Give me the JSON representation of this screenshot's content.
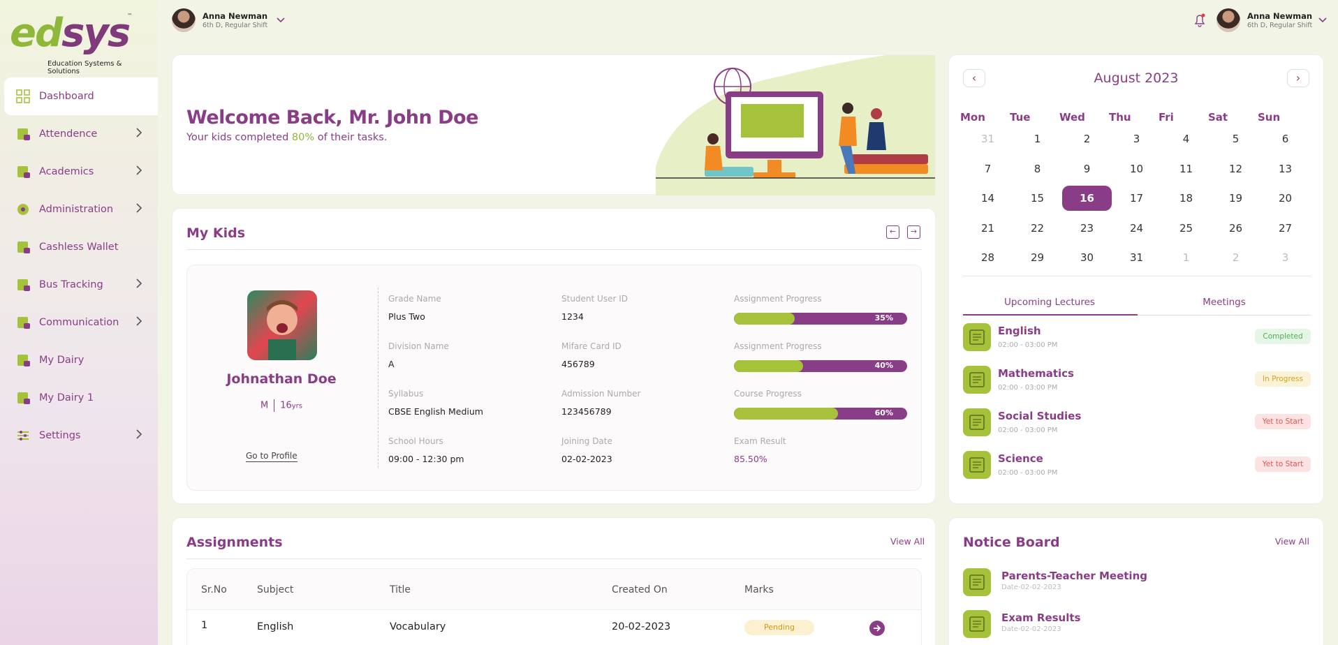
{
  "brand": {
    "name_part1": "ed",
    "name_part2": "sys",
    "tm": "™",
    "tagline": "Education Systems & Solutions"
  },
  "sidebar": {
    "items": [
      {
        "label": "Dashboard",
        "icon": "grid-icon",
        "active": true,
        "chevron": false
      },
      {
        "label": "Attendence",
        "icon": "attendance-icon",
        "active": false,
        "chevron": true
      },
      {
        "label": "Academics",
        "icon": "book-icon",
        "active": false,
        "chevron": true
      },
      {
        "label": "Administration",
        "icon": "cog-icon",
        "active": false,
        "chevron": true
      },
      {
        "label": "Cashless Wallet",
        "icon": "wallet-icon",
        "active": false,
        "chevron": false
      },
      {
        "label": "Bus Tracking",
        "icon": "bus-icon",
        "active": false,
        "chevron": true
      },
      {
        "label": "Communication",
        "icon": "chat-icon",
        "active": false,
        "chevron": true
      },
      {
        "label": "My Dairy",
        "icon": "diary-icon",
        "active": false,
        "chevron": false
      },
      {
        "label": "My Dairy 1",
        "icon": "diary-icon",
        "active": false,
        "chevron": false
      },
      {
        "label": "Settings",
        "icon": "sliders-icon",
        "active": false,
        "chevron": true
      }
    ]
  },
  "topbar": {
    "left_user": {
      "name": "Anna Newman",
      "meta": "6th D, Regular Shift"
    },
    "right_user": {
      "name": "Anna Newman",
      "meta": "6th D, Regular Shift"
    }
  },
  "welcome": {
    "title": "Welcome Back, Mr. John Doe",
    "sub_before": "Your kids completed ",
    "sub_pct": "80%",
    "sub_after": " of their tasks."
  },
  "kids": {
    "title": "My Kids",
    "name": "Johnathan Doe",
    "gender": "M",
    "age": "16",
    "age_unit": "yrs",
    "profile_link": "Go to Profile",
    "fields": {
      "grade_label": "Grade Name",
      "grade": "Plus Two",
      "userid_label": "Student User ID",
      "userid": "1234",
      "division_label": "Division Name",
      "division": "A",
      "mifare_label": "Mifare Card ID",
      "mifare": "456789",
      "syllabus_label": "Syllabus",
      "syllabus": "CBSE English Medium",
      "admission_label": "Admission Number",
      "admission": "123456789",
      "hours_label": "School Hours",
      "hours": "09:00 - 12:30 pm",
      "joining_label": "Joining Date",
      "joining": "02-02-2023",
      "exam_label": "Exam Result",
      "exam": "85.50%"
    },
    "progress": [
      {
        "label": "Assignment Progress",
        "value": 35,
        "text": "35%"
      },
      {
        "label": "Assignment Progress",
        "value": 40,
        "text": "40%"
      },
      {
        "label": "Course Progress",
        "value": 60,
        "text": "60%"
      }
    ]
  },
  "assignments": {
    "title": "Assignments",
    "view_all": "View All",
    "headers": [
      "Sr.No",
      "Subject",
      "Title",
      "Created On",
      "Marks"
    ],
    "rows": [
      {
        "srno": "1",
        "subject": "English",
        "title": "Vocabulary",
        "created": "20-02-2023",
        "marks": "Pending"
      }
    ]
  },
  "calendar": {
    "title": "August 2023",
    "dow": [
      "Mon",
      "Tue",
      "Wed",
      "Thu",
      "Fri",
      "Sat",
      "Sun"
    ],
    "days": [
      {
        "d": "31",
        "m": true
      },
      {
        "d": "1"
      },
      {
        "d": "2"
      },
      {
        "d": "3"
      },
      {
        "d": "4"
      },
      {
        "d": "5"
      },
      {
        "d": "6"
      },
      {
        "d": "7"
      },
      {
        "d": "8"
      },
      {
        "d": "9"
      },
      {
        "d": "10"
      },
      {
        "d": "11"
      },
      {
        "d": "12"
      },
      {
        "d": "13"
      },
      {
        "d": "14"
      },
      {
        "d": "15"
      },
      {
        "d": "16",
        "t": true
      },
      {
        "d": "17"
      },
      {
        "d": "18"
      },
      {
        "d": "19"
      },
      {
        "d": "20"
      },
      {
        "d": "21"
      },
      {
        "d": "22"
      },
      {
        "d": "23"
      },
      {
        "d": "24"
      },
      {
        "d": "25"
      },
      {
        "d": "26"
      },
      {
        "d": "27"
      },
      {
        "d": "28"
      },
      {
        "d": "29"
      },
      {
        "d": "30"
      },
      {
        "d": "31"
      },
      {
        "d": "1",
        "m": true
      },
      {
        "d": "2",
        "m": true
      },
      {
        "d": "3",
        "m": true
      }
    ]
  },
  "lectures": {
    "tabs": [
      "Upcoming Lectures",
      "Meetings"
    ],
    "items": [
      {
        "name": "English",
        "time": "02:00 - 03:00 PM",
        "status": "Completed",
        "bg": "#e6f6e6",
        "fg": "#4caf50"
      },
      {
        "name": "Mathematics",
        "time": "02:00 - 03:00 PM",
        "status": "In Progress",
        "bg": "#fbf3d9",
        "fg": "#d4a21b"
      },
      {
        "name": "Social Studies",
        "time": "02:00 - 03:00 PM",
        "status": "Yet to Start",
        "bg": "#fde2e2",
        "fg": "#e05555"
      },
      {
        "name": "Science",
        "time": "02:00 - 03:00 PM",
        "status": "Yet to Start",
        "bg": "#fde2e2",
        "fg": "#e05555"
      }
    ]
  },
  "notice": {
    "title": "Notice Board",
    "view_all": "View All",
    "items": [
      {
        "name": "Parents-Teacher Meeting",
        "date": "Date-02-02-2023"
      },
      {
        "name": "Exam Results",
        "date": "Date-02-02-2023"
      }
    ]
  },
  "colors": {
    "accent": "#8a3d87",
    "green": "#a6c23b"
  }
}
